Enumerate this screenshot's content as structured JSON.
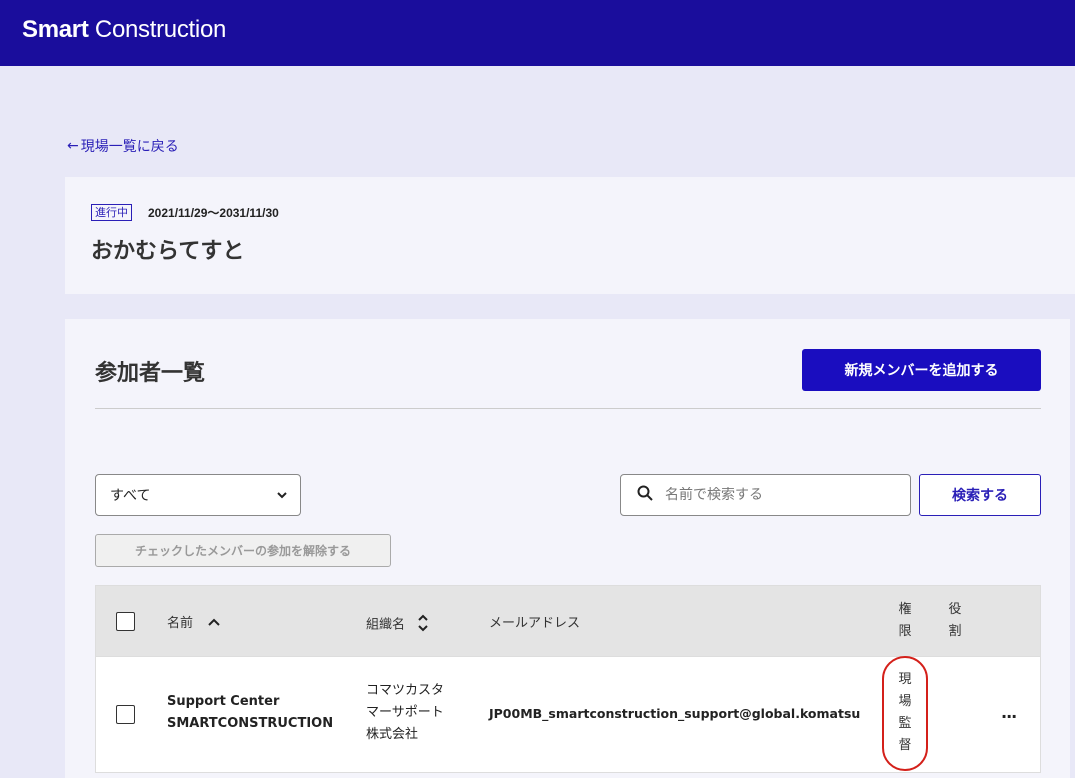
{
  "header": {
    "brand_bold": "Smart",
    "brand_light": "Construction"
  },
  "back_link": {
    "arrow": "←",
    "label": "現場一覧に戻る"
  },
  "project": {
    "status": "進行中",
    "period": "2021/11/29～2031/11/30",
    "name": "おかむらてすと"
  },
  "members": {
    "title": "参加者一覧",
    "add_button": "新規メンバーを追加する",
    "filter": {
      "selected": "すべて"
    },
    "search": {
      "placeholder": "名前で検索する",
      "button": "検索する"
    },
    "remove_button": "チェックしたメンバーの参加を解除する",
    "columns": {
      "name": "名前",
      "org": "組織名",
      "email": "メールアドレス",
      "auth": [
        "権",
        "限"
      ],
      "role": [
        "役",
        "割"
      ]
    },
    "rows": [
      {
        "name": [
          "Support Center",
          "SMARTCONSTRUCTION"
        ],
        "org": [
          "コマツカスタ",
          "マーサポート",
          "株式会社"
        ],
        "email": "JP00MB_smartconstruction_support@global.komatsu",
        "auth": [
          "現",
          "場",
          "監",
          "督"
        ],
        "more": "···"
      }
    ]
  },
  "colors": {
    "header": "#1a0d9c",
    "accent": "#1a0dbf",
    "highlight": "#d4201a"
  }
}
